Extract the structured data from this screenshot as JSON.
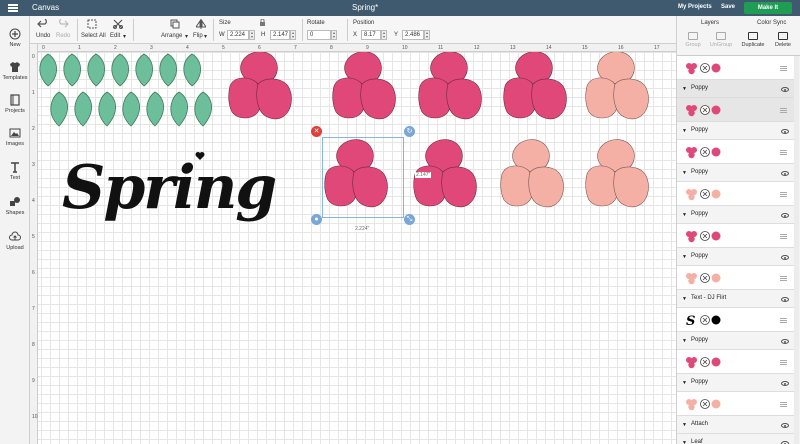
{
  "topbar": {
    "app_title": "Canvas",
    "doc_title": "Spring*",
    "my_projects": "My Projects",
    "save": "Save",
    "make_it": "Make It"
  },
  "toolbar": {
    "undo": "Undo",
    "redo": "Redo",
    "select_all": "Select All",
    "edit": "Edit",
    "arrange": "Arrange",
    "flip": "Flip",
    "size_label": "Size",
    "w_label": "W",
    "w_value": "2.224",
    "h_label": "H",
    "h_value": "2.147",
    "rotate_label": "Rotate",
    "rotate_value": "0",
    "position_label": "Position",
    "x_label": "X",
    "x_value": "8.17",
    "y_label": "Y",
    "y_value": "2.486"
  },
  "sidebar": [
    {
      "label": "New",
      "icon": "plus-circle-icon"
    },
    {
      "label": "Templates",
      "icon": "tshirt-icon"
    },
    {
      "label": "Projects",
      "icon": "book-icon"
    },
    {
      "label": "Images",
      "icon": "image-icon"
    },
    {
      "label": "Text",
      "icon": "text-icon"
    },
    {
      "label": "Shapes",
      "icon": "shapes-icon"
    },
    {
      "label": "Upload",
      "icon": "cloud-upload-icon"
    }
  ],
  "ruler": {
    "top": [
      "0",
      "1",
      "2",
      "3",
      "4",
      "5",
      "6",
      "7",
      "8",
      "9",
      "10",
      "11",
      "12",
      "13",
      "14",
      "15",
      "16",
      "17"
    ],
    "left": [
      "0",
      "1",
      "2",
      "3",
      "4",
      "5",
      "6",
      "7",
      "8",
      "9",
      "10",
      "11"
    ]
  },
  "canvas": {
    "spring_text": "Spring",
    "selection": {
      "width_label": "2.224\"",
      "height_label": "2.147\""
    },
    "colors": {
      "leaf": "#6dbf9c",
      "poppy_dark": "#e0487a",
      "poppy_light": "#f5b0a6",
      "selection": "#8bb4dd",
      "delete_handle": "#e0403a"
    }
  },
  "panel": {
    "tabs": {
      "layers": "Layers",
      "color_sync": "Color Sync"
    },
    "tools": {
      "group": "Group",
      "ungroup": "UnGroup",
      "duplicate": "Duplicate",
      "delete": "Delete"
    },
    "layers": [
      {
        "type": "item",
        "color": "#e0487a"
      },
      {
        "type": "group",
        "label": "Poppy",
        "selected": true
      },
      {
        "type": "item",
        "color": "#e0487a",
        "selected": true
      },
      {
        "type": "group",
        "label": "Poppy"
      },
      {
        "type": "item",
        "color": "#e0487a"
      },
      {
        "type": "group",
        "label": "Poppy"
      },
      {
        "type": "item",
        "color": "#f5b0a6"
      },
      {
        "type": "group",
        "label": "Poppy"
      },
      {
        "type": "item",
        "color": "#e0487a"
      },
      {
        "type": "group",
        "label": "Poppy"
      },
      {
        "type": "item",
        "color": "#f5b0a6"
      },
      {
        "type": "group",
        "label": "Text - DJ Flirt"
      },
      {
        "type": "item",
        "color": "#000000",
        "glyph": "S"
      },
      {
        "type": "group",
        "label": "Poppy"
      },
      {
        "type": "item",
        "color": "#e0487a"
      },
      {
        "type": "group",
        "label": "Poppy"
      },
      {
        "type": "item",
        "color": "#f5b0a6"
      },
      {
        "type": "group",
        "label": "Attach"
      },
      {
        "type": "group",
        "label": "Leaf"
      }
    ]
  }
}
